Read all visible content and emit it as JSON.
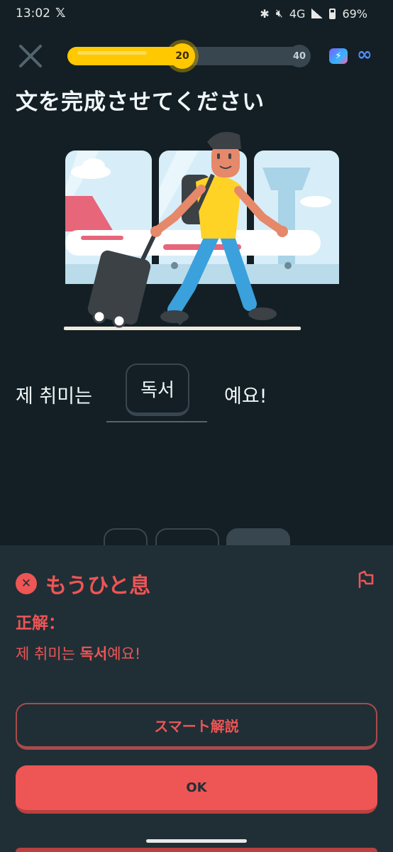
{
  "status_bar": {
    "time": "13:02",
    "x_app_icon": "x-logo-icon",
    "network": "4G",
    "battery": "69%",
    "icons": [
      "bluetooth-icon",
      "mute-icon",
      "signal-icon",
      "battery-icon"
    ]
  },
  "header": {
    "progress": {
      "current_label": "20",
      "goal_label": "40",
      "fraction": 0.48
    },
    "icons": [
      "close-icon",
      "energy-icon",
      "infinity-icon"
    ],
    "infinity_symbol": "∞"
  },
  "exercise": {
    "title": "文を完成させてください",
    "sentence_before": "제 취미는",
    "selected_word": "독서",
    "sentence_after": "예요!"
  },
  "feedback": {
    "status": "もうひと息",
    "correct_label": "正解：",
    "correct_answer_prefix": "제 취미는 ",
    "correct_answer_highlight": "독서",
    "correct_answer_suffix": "예요!",
    "explain_button": "スマート解説",
    "ok_button": "OK"
  },
  "colors": {
    "background": "#131f24",
    "sheet": "#202f36",
    "error": "#ee5555",
    "progress": "#ffc800"
  }
}
